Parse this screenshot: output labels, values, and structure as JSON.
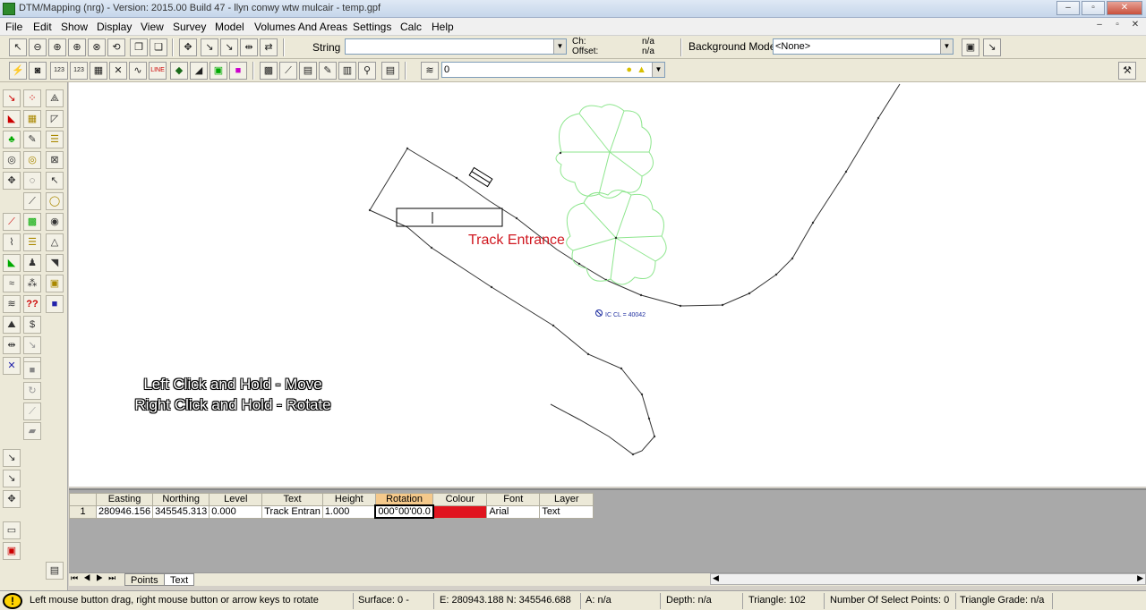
{
  "window": {
    "title": "DTM/Mapping (nrg) - Version: 2015.00 Build 47 - llyn conwy wtw mulcair - temp.gpf",
    "min": "‒",
    "max": "▫",
    "close": "✕"
  },
  "menu": [
    "File",
    "Edit",
    "Show",
    "Display",
    "View",
    "Survey",
    "Model",
    "Volumes And Areas",
    "Settings",
    "Calc",
    "Help"
  ],
  "toolbar1": {
    "string_label": "String",
    "string_value": "",
    "ch_label": "Ch:",
    "offset_label": "Offset:",
    "ch_value": "n/a",
    "offset_value": "n/a",
    "background_model_label": "Background Model:",
    "background_model_value": "<None>"
  },
  "toolbar2": {
    "layer_value": "0"
  },
  "canvas": {
    "annotation_text": "Track Entrance",
    "ic_label": "IC CL = 40042",
    "instruction_line1": "Left Click and Hold - Move",
    "instruction_line2": "Right Click and Hold - Rotate"
  },
  "grid": {
    "columns": [
      "",
      "Easting",
      "Northing",
      "Level",
      "Text",
      "Height",
      "Rotation",
      "Colour",
      "Font",
      "Layer"
    ],
    "rows": [
      {
        "index": "1",
        "easting": "280946.156",
        "northing": "345545.313",
        "level": "0.000",
        "text": "Track Entran",
        "height": "1.000",
        "rotation": "000°00'00.0",
        "colour": "#e0141e",
        "font": "Arial",
        "layer": "Text"
      }
    ]
  },
  "tabs": [
    "Points",
    "Text"
  ],
  "status": {
    "message": "Left mouse button drag, right mouse button or arrow keys to rotate",
    "surface": "Surface: 0 -",
    "coords": "E: 280943.188  N: 345546.688",
    "a": "A: n/a",
    "depth": "Depth: n/a",
    "triangle": "Triangle: 102",
    "num_select": "Number Of Select Points: 0",
    "triangle_grade": "Triangle Grade: n/a"
  },
  "colors": {
    "tree": "#8ee68e",
    "annotation": "#d01820",
    "ic": "#2030a0"
  }
}
